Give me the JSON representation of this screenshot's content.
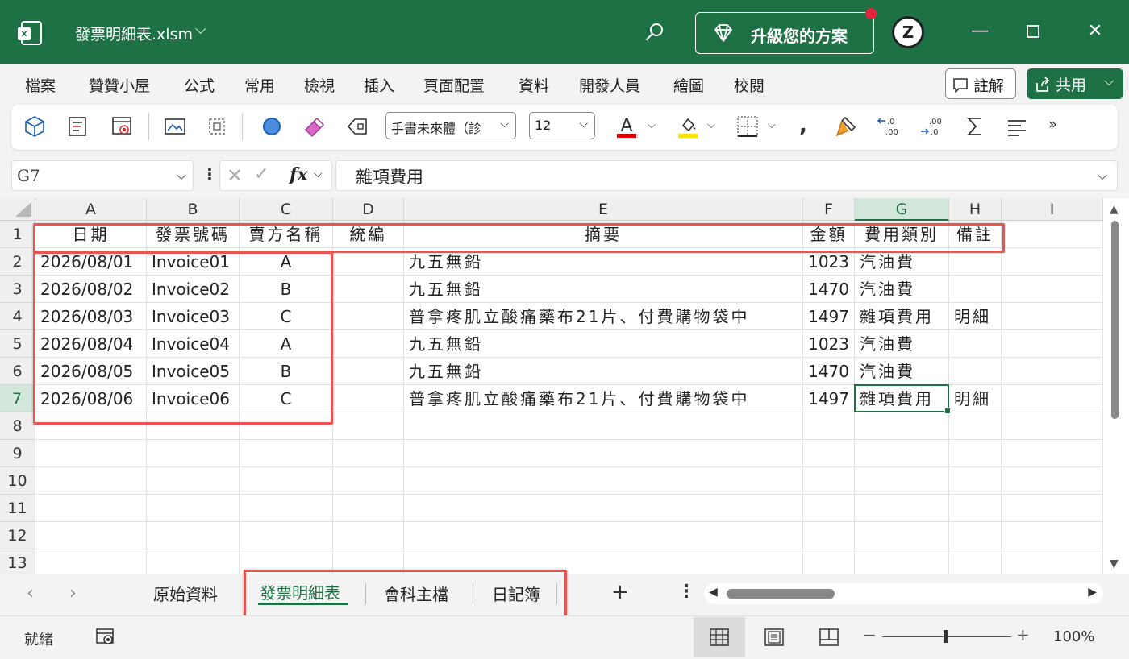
{
  "titlebar": {
    "file_name": "發票明細表.xlsm",
    "upgrade_label": "升級您的方案",
    "avatar_letter": "Z"
  },
  "menu": {
    "items": [
      "檔案",
      "贊贊小屋",
      "公式",
      "常用",
      "檢視",
      "插入",
      "頁面配置",
      "資料",
      "開發人員",
      "繪圖",
      "校閱"
    ],
    "note_label": "註解",
    "share_label": "共用"
  },
  "toolbar": {
    "font_name": "手書未來體（診",
    "font_size": "12",
    "font_color": "#e00000",
    "highlight_color": "#f5e400"
  },
  "formula_bar": {
    "name_box": "G7",
    "formula": "雜項費用"
  },
  "grid": {
    "columns": [
      "A",
      "B",
      "C",
      "D",
      "E",
      "F",
      "G",
      "H",
      "I"
    ],
    "rows": [
      "1",
      "2",
      "3",
      "4",
      "5",
      "6",
      "7",
      "8",
      "9",
      "10",
      "11",
      "12",
      "13"
    ],
    "active_cell": "G7",
    "header_row": [
      "日期",
      "發票號碼",
      "賣方名稱",
      "統編",
      "摘要",
      "金額",
      "費用類別",
      "備註"
    ],
    "data": [
      [
        "2026/08/01",
        "Invoice01",
        "A",
        "",
        "九五無鉛",
        "1023",
        "汽油費",
        ""
      ],
      [
        "2026/08/02",
        "Invoice02",
        "B",
        "",
        "九五無鉛",
        "1470",
        "汽油費",
        ""
      ],
      [
        "2026/08/03",
        "Invoice03",
        "C",
        "",
        "普拿疼肌立酸痛藥布21片、付費購物袋中",
        "1497",
        "雜項費用",
        "明細"
      ],
      [
        "2026/08/04",
        "Invoice04",
        "A",
        "",
        "九五無鉛",
        "1023",
        "汽油費",
        ""
      ],
      [
        "2026/08/05",
        "Invoice05",
        "B",
        "",
        "九五無鉛",
        "1470",
        "汽油費",
        ""
      ],
      [
        "2026/08/06",
        "Invoice06",
        "C",
        "",
        "普拿疼肌立酸痛藥布21片、付費購物袋中",
        "1497",
        "雜項費用",
        "明細"
      ]
    ]
  },
  "sheets": {
    "tabs": [
      "原始資料",
      "發票明細表",
      "會科主檔",
      "日記簿"
    ],
    "active": "發票明細表"
  },
  "status": {
    "ready": "就緒",
    "zoom": "100%"
  },
  "colors": {
    "brand": "#1e7145",
    "highlight_border": "#e8554e"
  }
}
